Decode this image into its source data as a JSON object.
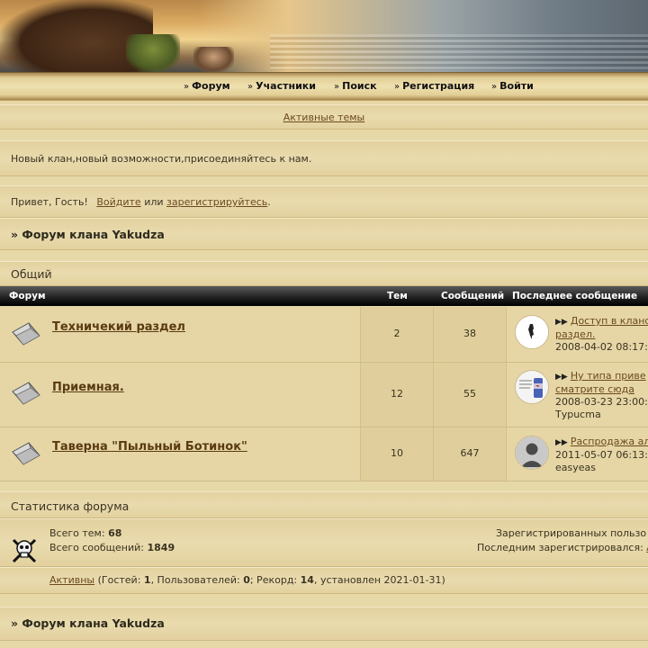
{
  "nav": [
    {
      "label": "Форум"
    },
    {
      "label": "Участники"
    },
    {
      "label": "Поиск"
    },
    {
      "label": "Регистрация"
    },
    {
      "label": "Войти"
    }
  ],
  "active_topics_link": "Активные темы",
  "announcement": "Новый клан,новый возможности,присоединяйтесь к нам.",
  "welcome": {
    "greeting": "Привет, Гость!",
    "login_link": "Войдите",
    "or": "или",
    "register_link": "зарегистрируйтесь",
    "period": "."
  },
  "board_title": "» Форум клана Yakudza",
  "category": "Общий",
  "table_headers": {
    "forum": "Форум",
    "topics": "Тем",
    "posts": "Сообщений",
    "last_post": "Последнее сообщение"
  },
  "forums": [
    {
      "name": "Техничекий раздел",
      "topics": "2",
      "posts": "38",
      "last_topic_line1": "Доступ в клано",
      "last_topic_line2": "раздел.",
      "last_date": "2008-04-02 08:17:",
      "last_author": ""
    },
    {
      "name": "Приемная.",
      "topics": "12",
      "posts": "55",
      "last_topic_line1": "Ну типа приве",
      "last_topic_line2": "сматрите сюда",
      "last_date": "2008-03-23 23:00:",
      "last_author": "Турucma"
    },
    {
      "name": "Таверна \"Пыльный Ботинок\"",
      "topics": "10",
      "posts": "647",
      "last_topic_line1": "Распродажа ал",
      "last_topic_line2": "",
      "last_date": "2011-05-07 06:13:",
      "last_author": "easyeas"
    }
  ],
  "stats": {
    "title": "Статистика форума",
    "total_topics_label": "Всего тем:",
    "total_topics": "68",
    "total_posts_label": "Всего сообщений:",
    "total_posts": "1849",
    "registered_label": "Зарегистрированных пользо",
    "last_registered_label": "Последним зарегистрировался:",
    "last_registered_user": "А",
    "online_link": "Активны",
    "guests_label": "(Гостей:",
    "guests": "1",
    "users_label": ", Пользователей:",
    "users": "0",
    "record_label": "; Рекорд:",
    "record": "14",
    "record_date": ", установлен 2021-01-31)"
  },
  "footer_title": "» Форум клана Yakudza"
}
